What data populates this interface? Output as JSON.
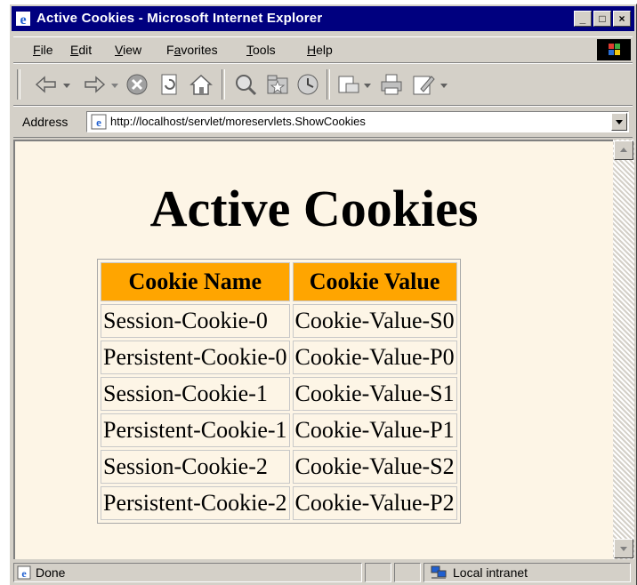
{
  "window": {
    "title": "Active Cookies - Microsoft Internet Explorer",
    "minimize_glyph": "_",
    "maximize_glyph": "□",
    "close_glyph": "×"
  },
  "menubar": {
    "items": [
      {
        "pre": "",
        "key": "F",
        "post": "ile"
      },
      {
        "pre": "",
        "key": "E",
        "post": "dit"
      },
      {
        "pre": "",
        "key": "V",
        "post": "iew"
      },
      {
        "pre": "F",
        "key": "a",
        "post": "vorites"
      },
      {
        "pre": "",
        "key": "T",
        "post": "ools"
      },
      {
        "pre": "",
        "key": "H",
        "post": "elp"
      }
    ]
  },
  "toolbar": {
    "icons": [
      "back-icon",
      "forward-icon",
      "stop-icon",
      "refresh-icon",
      "home-icon",
      "search-icon",
      "favorites-icon",
      "history-icon",
      "mail-icon",
      "print-icon",
      "edit-icon"
    ]
  },
  "address": {
    "label": "Address",
    "url": "http://localhost/servlet/moreservlets.ShowCookies"
  },
  "page": {
    "heading": "Active Cookies",
    "columns": [
      "Cookie Name",
      "Cookie Value"
    ],
    "rows": [
      [
        "Session-Cookie-0",
        "Cookie-Value-S0"
      ],
      [
        "Persistent-Cookie-0",
        "Cookie-Value-P0"
      ],
      [
        "Session-Cookie-1",
        "Cookie-Value-S1"
      ],
      [
        "Persistent-Cookie-1",
        "Cookie-Value-P1"
      ],
      [
        "Session-Cookie-2",
        "Cookie-Value-S2"
      ],
      [
        "Persistent-Cookie-2",
        "Cookie-Value-P2"
      ]
    ]
  },
  "statusbar": {
    "status": "Done",
    "zone": "Local intranet"
  },
  "colors": {
    "titlebar": "#00007f",
    "content_bg": "#fdf5e6",
    "header_bg": "#ffa500"
  }
}
